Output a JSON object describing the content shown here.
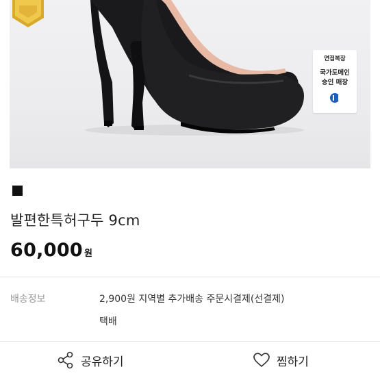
{
  "product_image": {
    "badge": {
      "line1": "면접복장",
      "line2": "국가도메인",
      "line3": "승인 매장"
    }
  },
  "product": {
    "title": "발편한특허구두 9cm",
    "price": "60,000",
    "currency": "원"
  },
  "shipping": {
    "label": "배송정보",
    "info": "2,900원 지역별 추가배송 주문시결제(선결제)",
    "method": "택배"
  },
  "actions": {
    "share_label": "공유하기",
    "like_label": "찜하기"
  },
  "colors": {
    "badge_logo": "#1f5fb5",
    "seal_gold": "#d8a92b"
  }
}
